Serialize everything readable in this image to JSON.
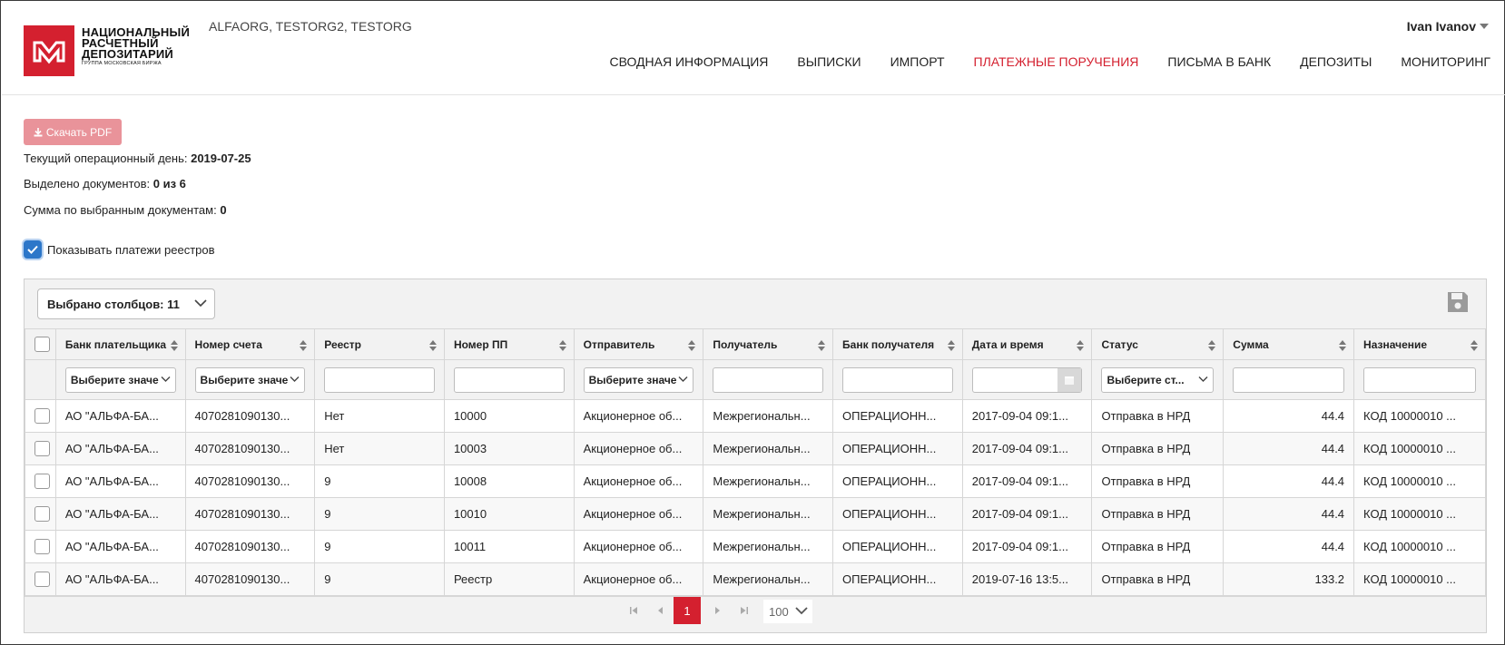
{
  "header": {
    "logo_lines": [
      "НАЦИОНАЛЬНЫЙ",
      "РАСЧЕТНЫЙ",
      "ДЕПОЗИТАРИЙ"
    ],
    "logo_sub": "ГРУППА МОСКОВСКАЯ БИРЖА",
    "orgs": "ALFAORG, TESTORG2, TESTORG",
    "user": "Ivan Ivanov",
    "nav": [
      {
        "label": "СВОДНАЯ ИНФОРМАЦИЯ",
        "active": false
      },
      {
        "label": "ВЫПИСКИ",
        "active": false
      },
      {
        "label": "ИМПОРТ",
        "active": false
      },
      {
        "label": "ПЛАТЕЖНЫЕ ПОРУЧЕНИЯ",
        "active": true
      },
      {
        "label": "ПИСЬМА В БАНК",
        "active": false
      },
      {
        "label": "ДЕПОЗИТЫ",
        "active": false
      },
      {
        "label": "МОНИТОРИНГ",
        "active": false
      }
    ]
  },
  "actions": {
    "download_pdf": "Скачать PDF"
  },
  "info": {
    "opday_label": "Текущий операционный день:",
    "opday_value": "2019-07-25",
    "selected_label": "Выделено документов:",
    "selected_value": "0 из 6",
    "sum_label": "Сумма по выбранным документам:",
    "sum_value": "0",
    "show_registry_label": "Показывать платежи реестров",
    "show_registry_checked": true
  },
  "grid": {
    "columns_selected": "Выбрано столбцов: 11",
    "columns": [
      "Банк плательщика",
      "Номер счета",
      "Реестр",
      "Номер ПП",
      "Отправитель",
      "Получатель",
      "Банк получателя",
      "Дата и время",
      "Статус",
      "Сумма",
      "Назначение"
    ],
    "filters": {
      "bank_payer": "Выберите значе",
      "account": "Выберите значе",
      "sender": "Выберите значе",
      "status": "Выберите ст..."
    },
    "rows": [
      [
        "АО \"АЛЬФА-БА...",
        "4070281090130...",
        "Нет",
        "10000",
        "Акционерное об...",
        "Межрегиональн...",
        "ОПЕРАЦИОНН...",
        "2017-09-04 09:1...",
        "Отправка в НРД",
        "44.4",
        "КОД 10000010 ..."
      ],
      [
        "АО \"АЛЬФА-БА...",
        "4070281090130...",
        "Нет",
        "10003",
        "Акционерное об...",
        "Межрегиональн...",
        "ОПЕРАЦИОНН...",
        "2017-09-04 09:1...",
        "Отправка в НРД",
        "44.4",
        "КОД 10000010 ..."
      ],
      [
        "АО \"АЛЬФА-БА...",
        "4070281090130...",
        "9",
        "10008",
        "Акционерное об...",
        "Межрегиональн...",
        "ОПЕРАЦИОНН...",
        "2017-09-04 09:1...",
        "Отправка в НРД",
        "44.4",
        "КОД 10000010 ..."
      ],
      [
        "АО \"АЛЬФА-БА...",
        "4070281090130...",
        "9",
        "10010",
        "Акционерное об...",
        "Межрегиональн...",
        "ОПЕРАЦИОНН...",
        "2017-09-04 09:1...",
        "Отправка в НРД",
        "44.4",
        "КОД 10000010 ..."
      ],
      [
        "АО \"АЛЬФА-БА...",
        "4070281090130...",
        "9",
        "10011",
        "Акционерное об...",
        "Межрегиональн...",
        "ОПЕРАЦИОНН...",
        "2017-09-04 09:1...",
        "Отправка в НРД",
        "44.4",
        "КОД 10000010 ..."
      ],
      [
        "АО \"АЛЬФА-БА...",
        "4070281090130...",
        "9",
        "Реестр",
        "Акционерное об...",
        "Межрегиональн...",
        "ОПЕРАЦИОНН...",
        "2019-07-16 13:5...",
        "Отправка в НРД",
        "133.2",
        "КОД 10000010 ..."
      ]
    ]
  },
  "pager": {
    "current_page": "1",
    "page_size": "100"
  },
  "colors": {
    "brand_red": "#d4202f",
    "checkbox_blue": "#2d77c9"
  },
  "icons": [
    "download-icon",
    "chevron-down-icon",
    "save-icon",
    "calendar-icon",
    "sort-icon",
    "first-page-icon",
    "prev-page-icon",
    "next-page-icon",
    "last-page-icon"
  ]
}
